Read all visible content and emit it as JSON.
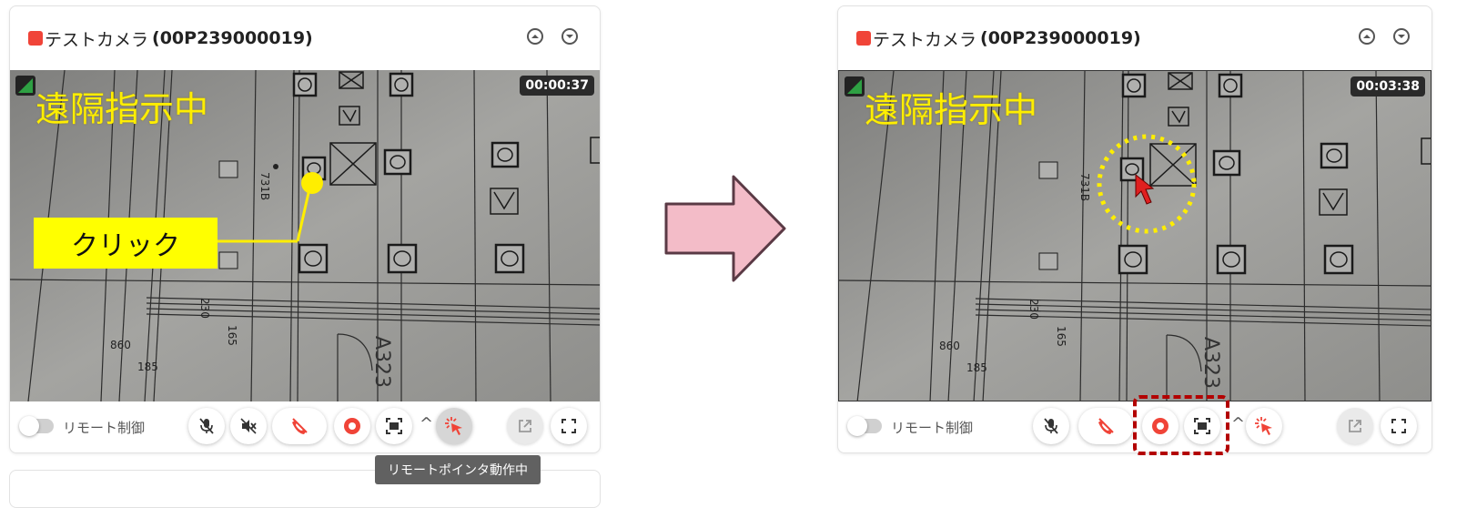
{
  "left_panel": {
    "title_jp": "テストカメラ",
    "title_id": "(00P239000019)",
    "timer": "00:00:37",
    "remote_label": "遠隔指示中",
    "annotation_click": "クリック",
    "toggle_label": "リモート制御",
    "tooltip": "リモートポインタ動作中"
  },
  "right_panel": {
    "title_jp": "テストカメラ",
    "title_id": "(00P239000019)",
    "timer": "00:03:38",
    "remote_label": "遠隔指示中",
    "toggle_label": "リモート制御"
  },
  "blueprint_labels": {
    "room_number": "A323",
    "label_731b": "731B",
    "dim_230": "230",
    "dim_165": "165",
    "dim_860": "860",
    "dim_185": "185"
  },
  "colors": {
    "status": "#f04438",
    "overlay_text": "#ffee00",
    "annotation_fill": "#ffff00",
    "arrow_fill": "#f3bcc8",
    "arrow_stroke": "#5a3a45",
    "highlight_border": "#b30000",
    "record_red": "#f04438"
  },
  "icons": [
    "status-dot-icon",
    "chevron-up-icon",
    "chevron-down-icon",
    "signal-icon",
    "mic-off-icon",
    "speaker-off-icon",
    "hang-up-icon",
    "record-icon",
    "screenshot-icon",
    "caret-up-icon",
    "remote-pointer-icon",
    "popout-icon",
    "fullscreen-icon",
    "cursor-arrow-icon"
  ]
}
